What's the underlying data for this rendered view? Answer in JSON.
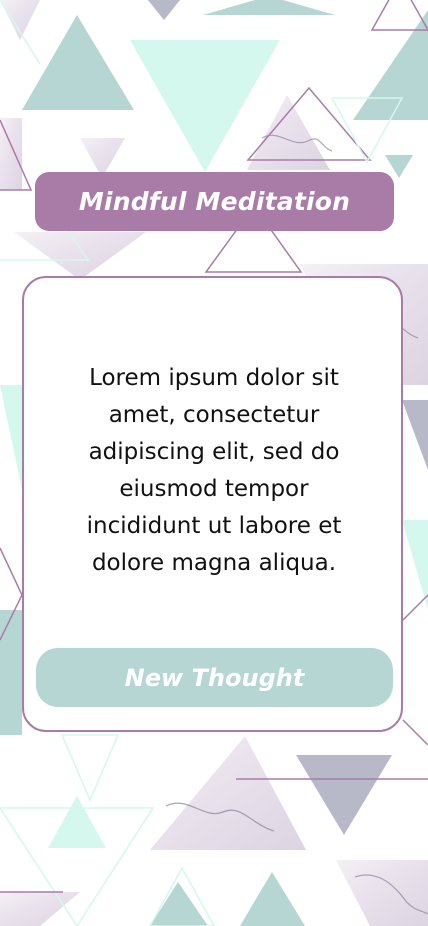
{
  "app": {
    "title": "Mindful Meditation"
  },
  "quote": {
    "text": "Lorem ipsum dolor sit amet, consectetur adipiscing elit, sed do eiusmod tempor incididunt ut labore et dolore magna aliqua."
  },
  "actions": {
    "new_thought_label": "New Thought"
  },
  "colors": {
    "title_banner": "#a97ca8",
    "button": "#b5d6d2",
    "card_border": "#a97ca8",
    "pattern_teal": "#b5d6d2",
    "pattern_mint": "#d4f8ee",
    "pattern_lavender": "#b7b9c9",
    "pattern_marble": "#efe8ef"
  }
}
